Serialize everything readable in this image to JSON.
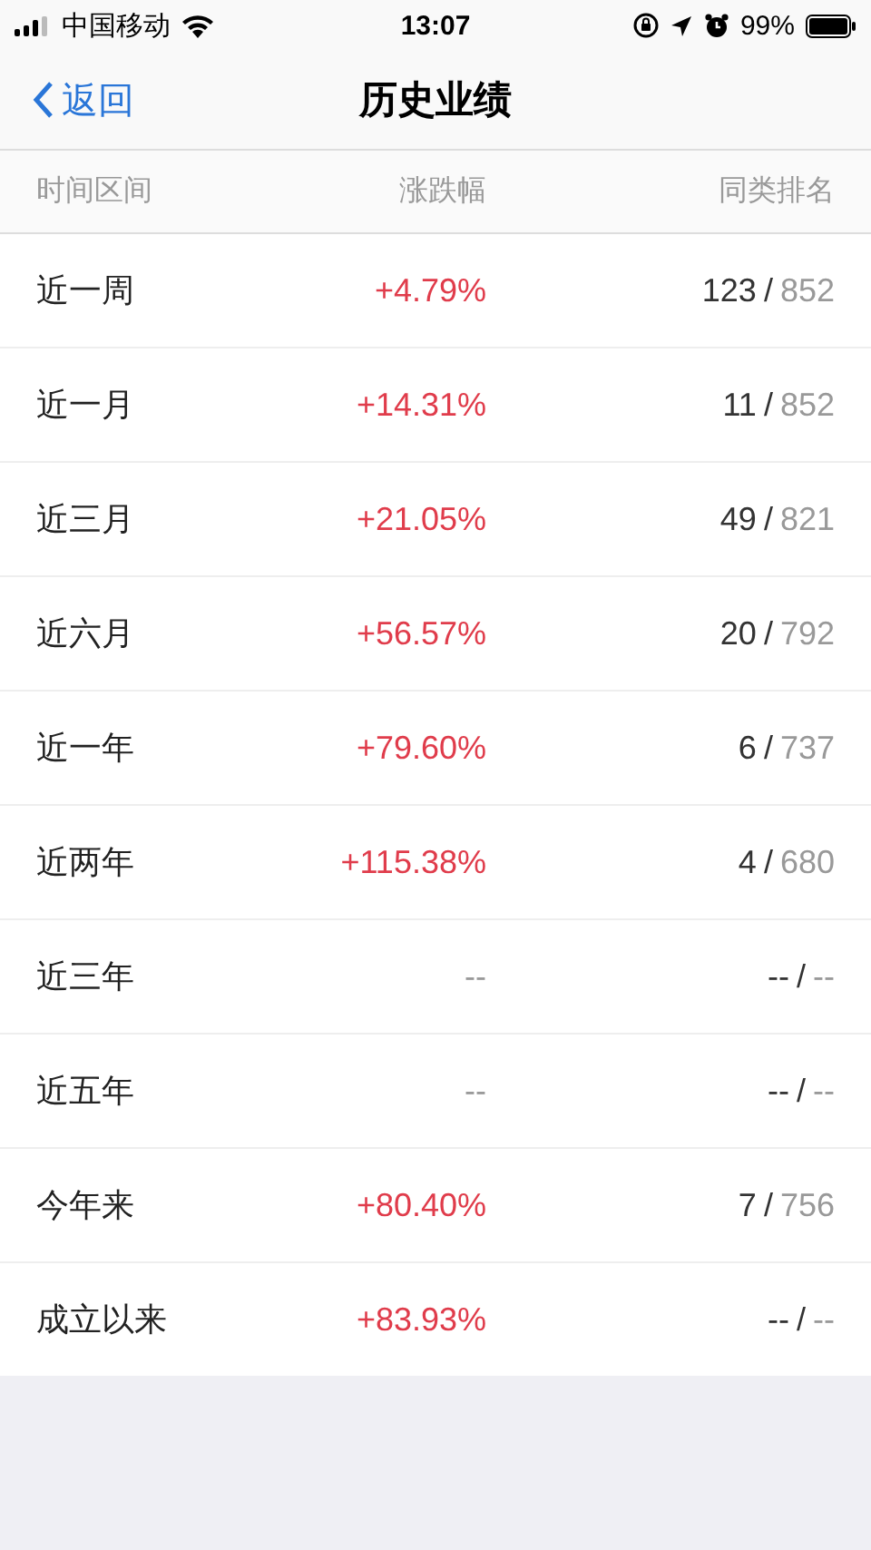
{
  "status_bar": {
    "carrier": "中国移动",
    "time": "13:07",
    "battery": "99%"
  },
  "nav": {
    "back": "返回",
    "title": "历史业绩"
  },
  "table": {
    "columns": [
      "时间区间",
      "涨跌幅",
      "同类排名"
    ],
    "rows": [
      {
        "period": "近一周",
        "change": "+4.79%",
        "kind": "gain",
        "rank": "123",
        "separator": "/",
        "total": "852"
      },
      {
        "period": "近一月",
        "change": "+14.31%",
        "kind": "gain",
        "rank": "11",
        "separator": "/",
        "total": "852"
      },
      {
        "period": "近三月",
        "change": "+21.05%",
        "kind": "gain",
        "rank": "49",
        "separator": "/",
        "total": "821"
      },
      {
        "period": "近六月",
        "change": "+56.57%",
        "kind": "gain",
        "rank": "20",
        "separator": "/",
        "total": "792"
      },
      {
        "period": "近一年",
        "change": "+79.60%",
        "kind": "gain",
        "rank": "6",
        "separator": "/",
        "total": "737"
      },
      {
        "period": "近两年",
        "change": "+115.38%",
        "kind": "gain",
        "rank": "4",
        "separator": "/",
        "total": "680"
      },
      {
        "period": "近三年",
        "change": "--",
        "kind": "empty",
        "rank": "--",
        "separator": "/",
        "total": "--"
      },
      {
        "period": "近五年",
        "change": "--",
        "kind": "empty",
        "rank": "--",
        "separator": "/",
        "total": "--"
      },
      {
        "period": "今年来",
        "change": "+80.40%",
        "kind": "gain",
        "rank": "7",
        "separator": "/",
        "total": "756"
      },
      {
        "period": "成立以来",
        "change": "+83.93%",
        "kind": "gain",
        "rank": "--",
        "separator": "/",
        "total": "--"
      }
    ]
  }
}
